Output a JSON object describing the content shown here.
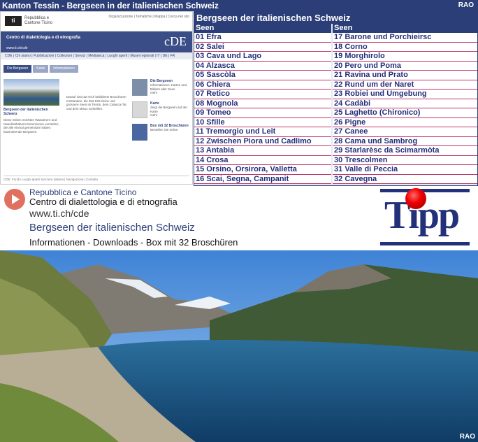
{
  "header": {
    "title": "Kanton Tessin - Bergseen in der italienischen Schweiz",
    "credit": "RAO"
  },
  "screenshot": {
    "logo": "ti",
    "gov_name": "Repubblica e Cantone Ticino",
    "top_links": "Organizzazione | Tematiche | Mappa | Cerca nel sito",
    "site_title": "Centro di dialettologia e di etnografia",
    "site_url": "www.ti.ch/cde",
    "site_mark": "cDE",
    "nav": "CDE | Chi siamo | Pubblicazioni | Collezioni | Servizi | Mediateca | Luoghi aperti | Musei regionali | IT | DE | FR",
    "tabs": [
      "Die Bergseen",
      "Karte",
      "Informationen"
    ],
    "lead_caption": "Bergseen der italienischen Schweiz",
    "lead_text": "Diese Seiten möchten Wanderern und Naturliebhabern Exkursionen vorstellen, die alle einmal gemeinsam haben: faszinierende Bergseen.",
    "body_text": "Darauf sind 32 reich bebilderte Broschüren entstanden, die fast 100 kleine und grössere Seen im Tessin, dem Calanca-Tal und dem Misox vorstellen.",
    "boxes": [
      {
        "title": "Die Bergseen",
        "text": "Informationen, Karten und Bildern aller Seen",
        "link": "mehr"
      },
      {
        "title": "Karte",
        "text": "Zeigt die Bergseen auf der Karte",
        "link": "mehr"
      },
      {
        "title": "Box mit 32 Broschüren",
        "text": "",
        "link": "Bestellen Sie online"
      }
    ],
    "footer": "CDE: Fondo Luoghi aperti Svizzera italiana | Navigazione | Contatto"
  },
  "table": {
    "title": "Bergseen der italienischen Schweiz",
    "col_header": "Seen",
    "left": [
      "01 Efra",
      "02 Salei",
      "03 Cava und Lago",
      "04 Alzasca",
      "05 Sascòla",
      "06 Chiera",
      "07 Retico",
      "08 Mognola",
      "09 Tomeo",
      "10 Sfille",
      "11 Tremorgio und Leit",
      "12 Zwischen Piora und Cadlimo",
      "13 Antabia",
      "14 Crosa",
      "15 Orsino, Orsirora, Valletta",
      "16 Scai, Segna, Campanit"
    ],
    "right": [
      "17 Barone und Porchieirsc",
      "18 Corno",
      "19 Morghirolo",
      "20 Pero und Poma",
      "21 Ravina und Prato",
      "22 Rund um der Naret",
      "23 Robiei und Umgebung",
      "24 Cadàbi",
      "25 Laghetto (Chironico)",
      "26 Pigne",
      "27 Canee",
      "28 Cama und Sambrog",
      "29 Starlarèsc da Scimarmòta",
      "30 Trescolmen",
      "31 Valle di Peccia",
      "32 Cavegna"
    ]
  },
  "info": {
    "line1": "Repubblica e Cantone Ticino",
    "line2": "Centro di dialettologia e di etnografia",
    "line3": "www.ti.ch/cde",
    "line4": "Bergseen der italienischen Schweiz",
    "line5": "Informationen - Downloads - Box mit 32 Broschüren",
    "tipp": "Tipp"
  },
  "photo": {
    "credit": "RAO"
  }
}
